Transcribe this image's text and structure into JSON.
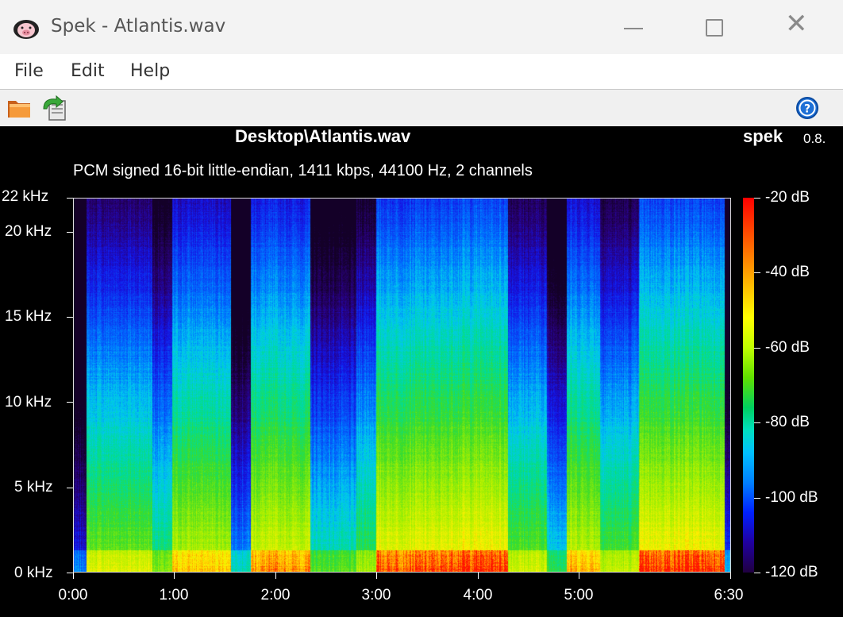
{
  "window": {
    "title": "Spek - Atlantis.wav",
    "close_glyph": "✕"
  },
  "menu": [
    "File",
    "Edit",
    "Help"
  ],
  "toolbar": {
    "icons": [
      "open-folder-icon",
      "reload-icon",
      "help-icon"
    ]
  },
  "header": {
    "file_path": "Desktop\\Atlantis.wav",
    "brand": "spek",
    "version": "0.8.",
    "stream_info": "PCM signed 16-bit little-endian, 1411 kbps, 44100 Hz, 2 channels"
  },
  "chart_data": {
    "type": "heatmap",
    "title": "",
    "x_ticks": [
      "0:00",
      "1:00",
      "2:00",
      "3:00",
      "4:00",
      "5:00",
      "6:30"
    ],
    "y_ticks": [
      "22 kHz",
      "20 kHz",
      "15 kHz",
      "10 kHz",
      "5 kHz",
      "0 kHz"
    ],
    "colorbar_ticks": [
      "-20 dB",
      "-40 dB",
      "-60 dB",
      "-80 dB",
      "-100 dB",
      "-120 dB"
    ],
    "x_range_seconds": [
      0,
      390
    ],
    "y_range_khz": [
      0,
      22
    ],
    "db_range": [
      -120,
      -20
    ]
  }
}
